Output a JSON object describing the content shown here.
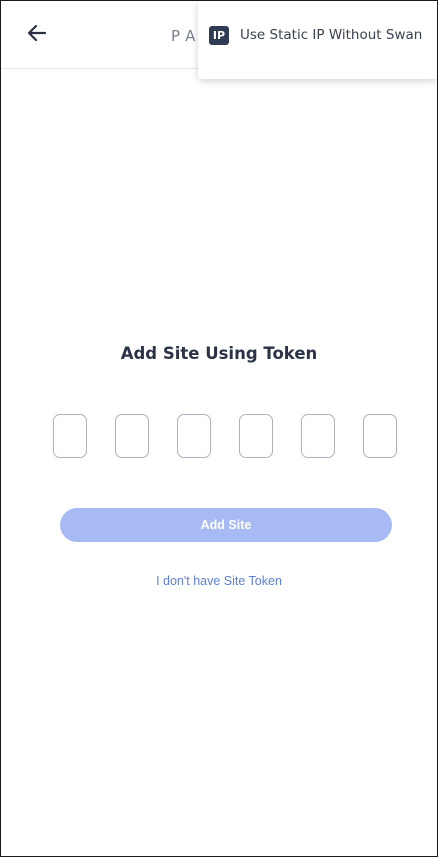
{
  "header": {
    "back_icon": "arrow-left-icon",
    "brand_text": "PA"
  },
  "popover": {
    "item": {
      "badge": "IP",
      "label": "Use Static IP Without Swan"
    }
  },
  "main": {
    "title": "Add Site Using Token",
    "token_boxes": [
      "",
      "",
      "",
      "",
      "",
      ""
    ],
    "add_site_label": "Add Site",
    "no_token_link": "I don't have Site Token"
  },
  "colors": {
    "button_disabled": "#a8baf4",
    "link": "#5d7fd6",
    "badge_bg": "#2f3b55"
  }
}
